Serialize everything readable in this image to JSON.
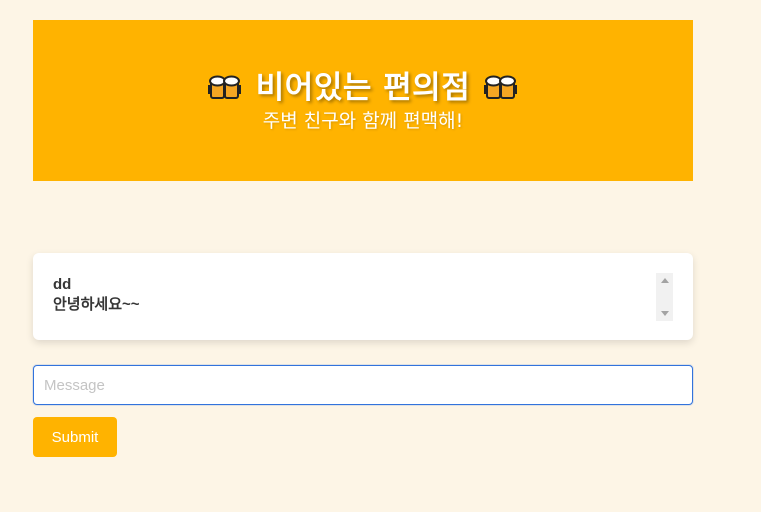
{
  "header": {
    "title": "비어있는 편의점",
    "subtitle": "주변 친구와 함께 편맥해!",
    "icons": [
      "beer-mugs-icon",
      "beer-mugs-icon"
    ],
    "background_color": "#ffb300"
  },
  "chat": {
    "messages": [
      {
        "user": "dd",
        "text": "안녕하세요~~"
      }
    ]
  },
  "form": {
    "message_placeholder": "Message",
    "message_value": "",
    "submit_label": "Submit"
  },
  "colors": {
    "page_background": "#fdf5e6",
    "accent": "#ffb300",
    "input_focus_border": "#3273dc"
  }
}
